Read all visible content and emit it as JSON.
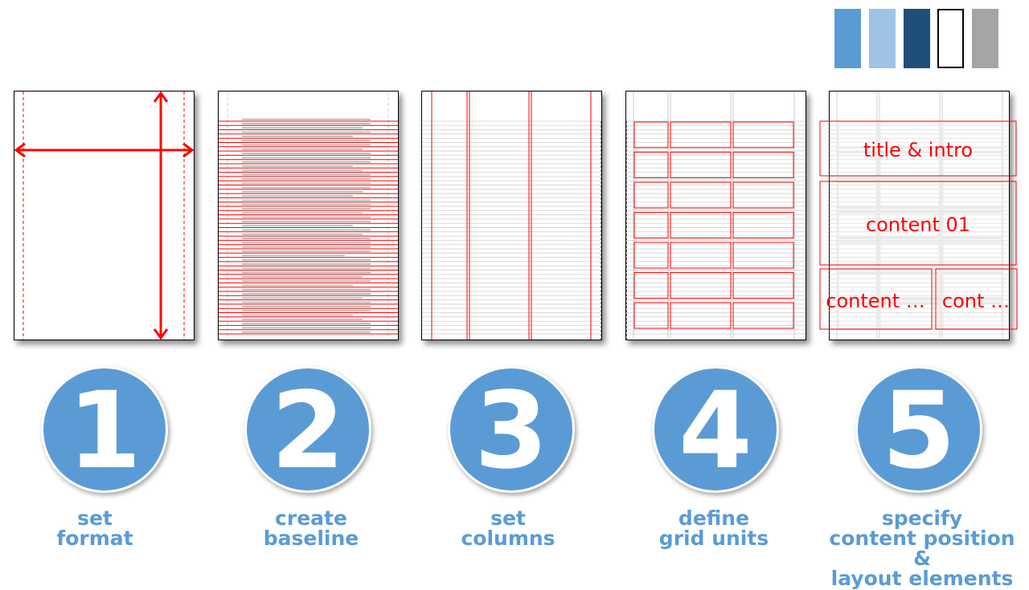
{
  "palette": {
    "swatches": [
      {
        "name": "medium-blue",
        "color": "#5b9bd5",
        "border": "none"
      },
      {
        "name": "light-blue",
        "color": "#9dc3e6",
        "border": "none"
      },
      {
        "name": "dark-blue",
        "color": "#1f4e79",
        "border": "none"
      },
      {
        "name": "white",
        "color": "#ffffff",
        "border": "#000000"
      },
      {
        "name": "gray",
        "color": "#a5a5a5",
        "border": "none"
      }
    ]
  },
  "colors": {
    "accent": "#5b9bd5",
    "guide_red": "#ff0000",
    "baseline_gray": "#d9d9d9"
  },
  "steps": [
    {
      "number": "1",
      "label_lines": [
        "set",
        "format"
      ]
    },
    {
      "number": "2",
      "label_lines": [
        "create",
        "baseline"
      ]
    },
    {
      "number": "3",
      "label_lines": [
        "set",
        "columns"
      ]
    },
    {
      "number": "4",
      "label_lines": [
        "define",
        "grid units"
      ]
    },
    {
      "number": "5",
      "label_lines": [
        "specify",
        "content position &",
        "layout elements"
      ]
    }
  ],
  "layout_zones": {
    "title": "title & intro",
    "content_main": "content 01",
    "content_left": "content …",
    "content_right": "cont …"
  }
}
